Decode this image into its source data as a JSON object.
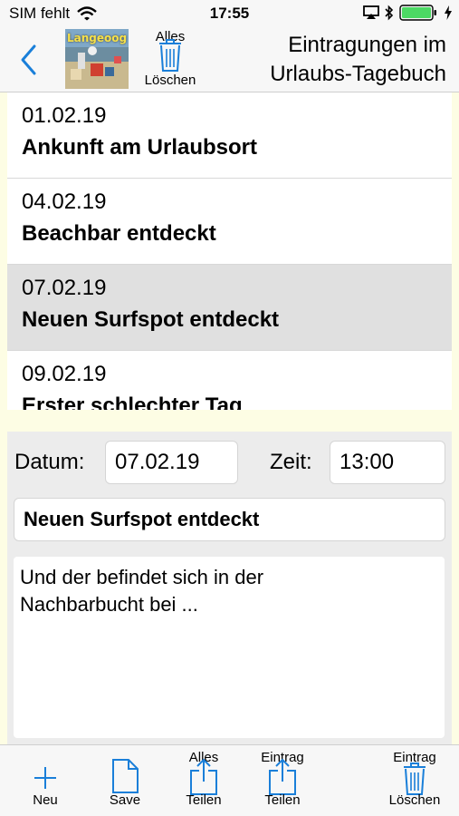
{
  "status": {
    "carrier": "SIM fehlt",
    "time": "17:55"
  },
  "nav": {
    "back_icon": "chevron-left-icon",
    "thumbnail_label": "Langeoog",
    "delete_all_top": "Alles",
    "delete_all_bottom": "Löschen",
    "title_line1": "Eintragungen im",
    "title_line2": "Urlaubs-Tagebuch"
  },
  "entries": [
    {
      "date": "01.02.19",
      "title": "Ankunft am Urlaubsort"
    },
    {
      "date": "04.02.19",
      "title": "Beachbar entdeckt"
    },
    {
      "date": "07.02.19",
      "title": "Neuen Surfspot entdeckt"
    },
    {
      "date": "09.02.19",
      "title": "Erster schlechter Tag"
    }
  ],
  "form": {
    "date_label": "Datum:",
    "date_value": "07.02.19",
    "time_label": "Zeit:",
    "time_value": "13:00",
    "title_value": "Neuen Surfspot entdeckt",
    "body_line1": "Und der befindet sich in der",
    "body_line2": "Nachbarbucht bei ..."
  },
  "toolbar": {
    "new_label": "Neu",
    "save_label": "Save",
    "share_all_top": "Alles",
    "share_all_bottom": "Teilen",
    "share_entry_top": "Eintrag",
    "share_entry_bottom": "Teilen",
    "delete_entry_top": "Eintrag",
    "delete_entry_bottom": "Löschen"
  },
  "colors": {
    "accent": "#1a7fd9",
    "battery": "#4cd964",
    "background": "#fdfde4",
    "selected_row": "#e0e0e0"
  }
}
